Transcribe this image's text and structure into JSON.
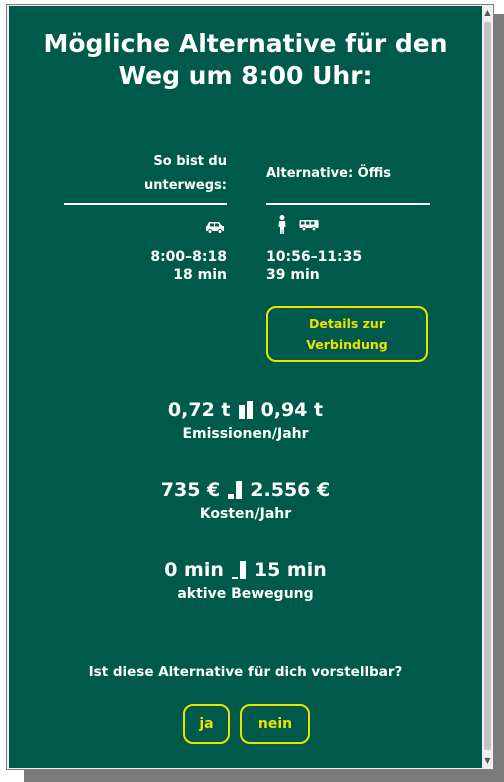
{
  "title_line1": "Mögliche Alternative für den",
  "title_line2": "Weg um 8:00 Uhr:",
  "columns": {
    "current": {
      "heading_line1": "So bist du",
      "heading_line2": "unterwegs:",
      "time": "8:00–8:18",
      "duration": "18 min",
      "icons": [
        "car-icon"
      ]
    },
    "alternative": {
      "heading": "Alternative: Öffis",
      "time": "10:56–11:35",
      "duration": "39 min",
      "icons": [
        "walking-person-icon",
        "bus-icon"
      ]
    }
  },
  "details_button": {
    "line1": "Details zur",
    "line2": "Verbindung"
  },
  "stats": {
    "emissions": {
      "current": "0,72 t",
      "alternative": "0,94 t",
      "label": "Emissionen/Jahr",
      "ratio": [
        0.77,
        1.0
      ]
    },
    "costs": {
      "current": "735 €",
      "alternative": "2.556 €",
      "label": "Kosten/Jahr",
      "ratio": [
        0.29,
        1.0
      ]
    },
    "activity": {
      "current": "0 min",
      "alternative": "15 min",
      "label": "aktive Bewegung",
      "ratio": [
        0.0,
        1.0
      ]
    }
  },
  "question": "Ist diese Alternative für dich vorstellbar?",
  "answers": {
    "yes": "ja",
    "no": "nein"
  },
  "colors": {
    "background": "#005a4b",
    "accent": "#f0e000",
    "text": "#ffffff"
  }
}
